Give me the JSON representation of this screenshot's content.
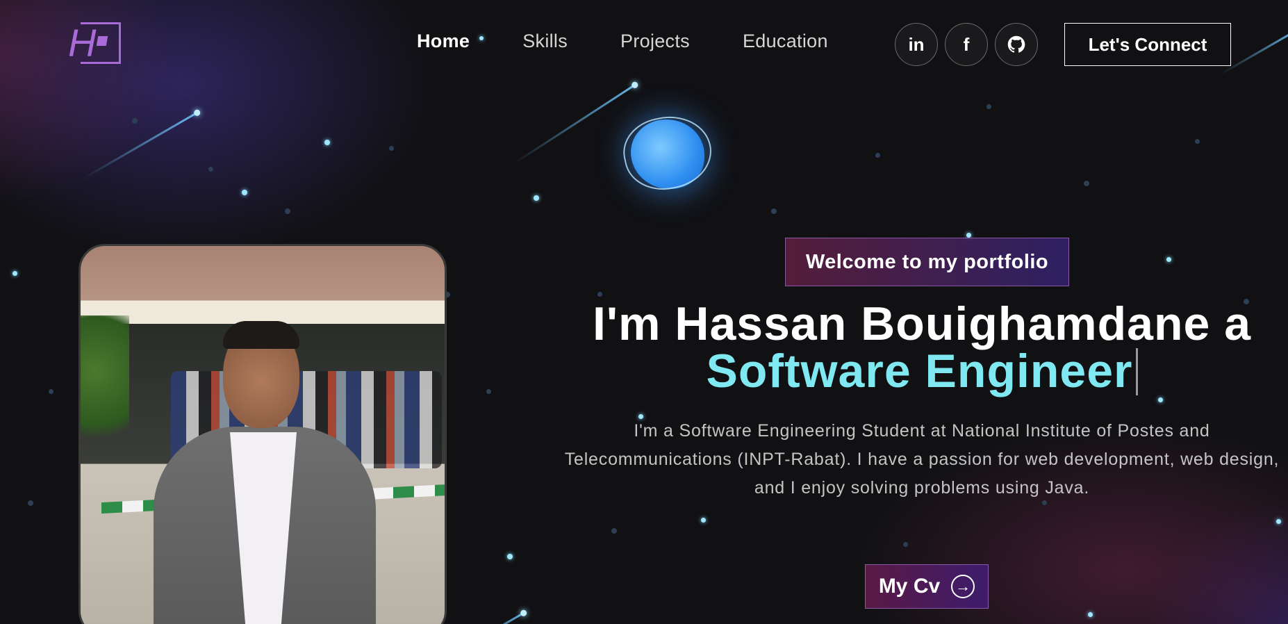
{
  "nav": {
    "links": [
      {
        "label": "Home",
        "active": true
      },
      {
        "label": "Skills",
        "active": false
      },
      {
        "label": "Projects",
        "active": false
      },
      {
        "label": "Education",
        "active": false
      }
    ],
    "socials": [
      {
        "icon": "linkedin-icon",
        "glyph": "in"
      },
      {
        "icon": "facebook-icon",
        "glyph": "f"
      },
      {
        "icon": "github-icon",
        "glyph": "◕"
      }
    ],
    "connect_label": "Let's Connect"
  },
  "hero": {
    "badge": "Welcome to my portfolio",
    "headline_prefix": "I'm Hassan Bouighamdane a",
    "headline_role": "Software Engineer",
    "intro": "I'm a Software Engineering Student at National Institute of Postes and Telecommunications (INPT-Rabat). I have a passion for web development, web design, and I enjoy solving problems using Java.",
    "cv_label": "My Cv",
    "cv_icon": "arrow-right-circle-icon"
  },
  "colors": {
    "background": "#111114",
    "accent_cyan": "#7fe8f0",
    "accent_purple": "#a86bd8"
  }
}
